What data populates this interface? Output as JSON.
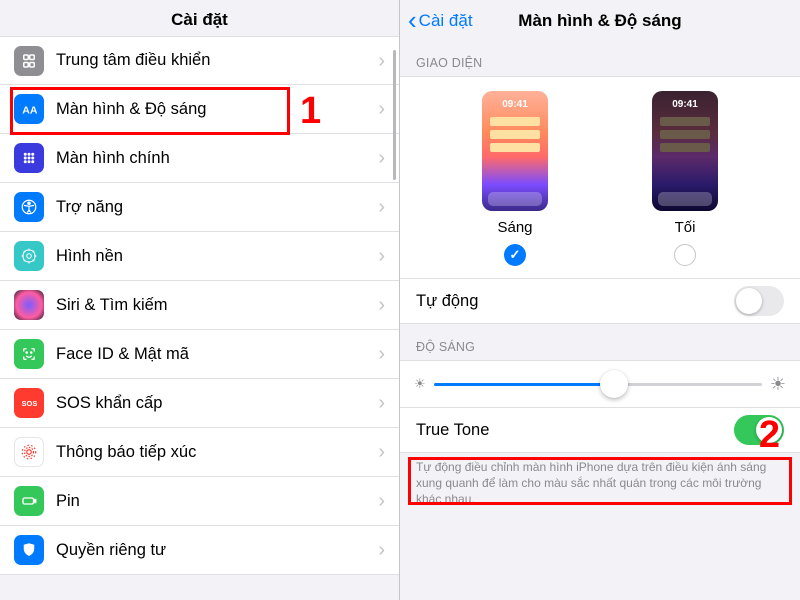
{
  "left": {
    "title": "Cài đặt",
    "items": [
      {
        "label": "Trung tâm điều khiển",
        "iconColor": "#8e8e93",
        "icon": "control-center"
      },
      {
        "label": "Màn hình & Độ sáng",
        "iconColor": "#007aff",
        "icon": "display"
      },
      {
        "label": "Màn hình chính",
        "iconColor": "#3a3adf",
        "icon": "home-screen"
      },
      {
        "label": "Trợ năng",
        "iconColor": "#007aff",
        "icon": "accessibility"
      },
      {
        "label": "Hình nền",
        "iconColor": "#36c7c7",
        "icon": "wallpaper"
      },
      {
        "label": "Siri & Tìm kiếm",
        "iconColor": "#222234",
        "icon": "siri"
      },
      {
        "label": "Face ID & Mật mã",
        "iconColor": "#34c759",
        "icon": "faceid"
      },
      {
        "label": "SOS khẩn cấp",
        "iconColor": "#ff3b30",
        "icon": "sos"
      },
      {
        "label": "Thông báo tiếp xúc",
        "iconColor": "#ffffff",
        "icon": "exposure"
      },
      {
        "label": "Pin",
        "iconColor": "#34c759",
        "icon": "battery"
      },
      {
        "label": "Quyền riêng tư",
        "iconColor": "#007aff",
        "icon": "privacy"
      }
    ]
  },
  "right": {
    "back": "Cài đặt",
    "title": "Màn hình & Độ sáng",
    "section_appearance": "GIAO DIỆN",
    "preview_time": "09:41",
    "light_label": "Sáng",
    "dark_label": "Tối",
    "auto_label": "Tự động",
    "section_brightness": "ĐỘ SÁNG",
    "truetone_label": "True Tone",
    "truetone_note": "Tự động điều chỉnh màn hình iPhone dựa trên điều kiện ánh sáng xung quanh để làm cho màu sắc nhất quán trong các môi trường khác nhau."
  },
  "annotations": {
    "n1": "1",
    "n2": "2"
  }
}
